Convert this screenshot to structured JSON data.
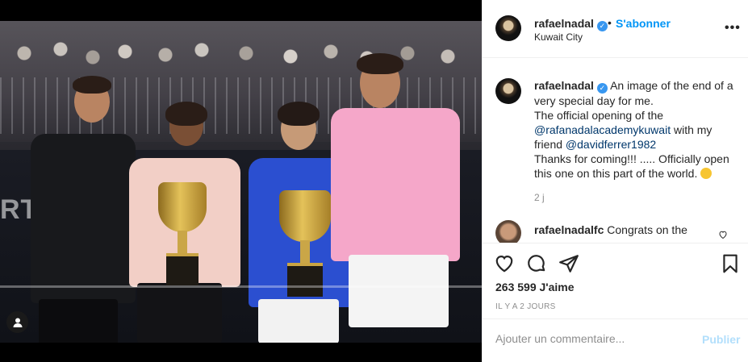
{
  "post": {
    "username": "rafaelnadal",
    "follow_label": "S'abonner",
    "separator": "•",
    "location": "Kuwait City",
    "more_label": "•••"
  },
  "caption": {
    "username": "rafaelnadal",
    "line1": "An image of the end of a very special day for me.",
    "line2": "The official opening of the",
    "mention1": "@rafanadalacademykuwait",
    "line3": "with my friend",
    "mention2": "@davidferrer1982",
    "line4": "Thanks for coming!!! ..... Officially open this one on this part of the world.",
    "age": "2 j"
  },
  "comment2": {
    "username": "rafaelnadalfc",
    "text": "Congrats on the"
  },
  "actions": {
    "likes": "263 599 J'aime",
    "time": "IL Y A 2 JOURS"
  },
  "add_comment": {
    "placeholder": "Ajouter un commentaire...",
    "publish_label": "Publier"
  },
  "photo": {
    "wall_text": "RT"
  },
  "colors": {
    "link_blue": "#0095f6",
    "mention_blue": "#00376b",
    "publish_disabled": "#b2dffc",
    "muted": "#8e8e8e",
    "text": "#262626"
  }
}
